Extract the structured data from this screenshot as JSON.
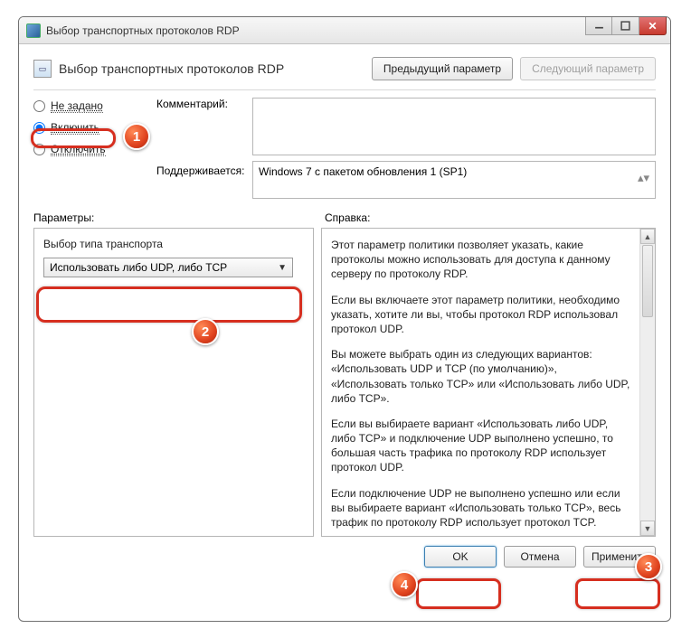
{
  "window": {
    "title": "Выбор транспортных протоколов RDP"
  },
  "header": {
    "title": "Выбор транспортных протоколов RDP",
    "prev": "Предыдущий параметр",
    "next": "Следующий параметр"
  },
  "radios": {
    "not_configured": "Не задано",
    "enabled": "Включить",
    "disabled": "Отключить"
  },
  "labels": {
    "comment": "Комментарий:",
    "supported": "Поддерживается:",
    "parameters": "Параметры:",
    "help": "Справка:"
  },
  "supported_text": "Windows 7 с пакетом обновления 1 (SP1)",
  "param": {
    "label": "Выбор типа транспорта",
    "value": "Использовать либо UDP, либо TCP"
  },
  "help_paragraphs": [
    "Этот параметр политики позволяет указать, какие протоколы можно использовать для доступа к данному серверу по протоколу RDP.",
    "Если вы включаете этот параметр политики, необходимо указать, хотите ли вы, чтобы протокол RDP использовал протокол UDP.",
    "Вы можете выбрать один из следующих вариантов: «Использовать UDP и TCP (по умолчанию)», «Использовать только TCP» или «Использовать либо UDP, либо TCP».",
    "Если вы выбираете вариант «Использовать либо UDP, либо TCP» и подключение UDP выполнено успешно, то большая часть трафика по протоколу RDP использует протокол UDP.",
    "Если подключение UDP не выполнено успешно или если вы выбираете вариант «Использовать только TCP», весь трафик по протоколу RDP использует протокол TCP."
  ],
  "buttons": {
    "ok": "OK",
    "cancel": "Отмена",
    "apply": "Применить"
  },
  "annotations": {
    "b1": "1",
    "b2": "2",
    "b3": "3",
    "b4": "4"
  }
}
